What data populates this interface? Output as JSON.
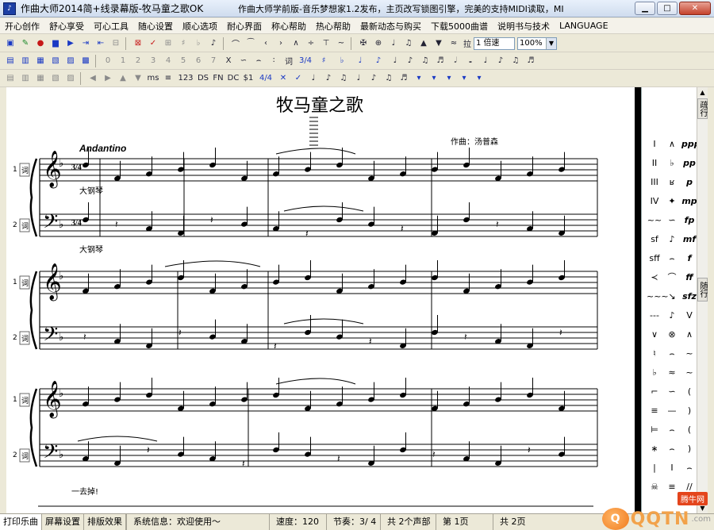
{
  "window": {
    "title": "作曲大师2014简+线录幕版-牧马童之歌OK",
    "title_right": "作曲大师学前版-音乐梦想家1.2发布，主页改写锁图引擎，完美的支持MIDI读取，MI",
    "controls": [
      "▁",
      "□",
      "✕"
    ]
  },
  "menu": [
    "开心创作",
    "舒心享受",
    "可心工具",
    "随心设置",
    "顺心选项",
    "耐心界面",
    "称心帮助",
    "热心帮助",
    "最新动态与购买",
    "下载5000曲谱",
    "说明书与技术",
    "LANGUAGE"
  ],
  "toolbar1": {
    "icons": [
      "▣",
      "✎",
      "●",
      "▆",
      "▶",
      "⇥",
      "⇤",
      "⊟",
      "⊠",
      "✓",
      "⊞",
      "♯",
      "♭",
      "♪",
      "⌒",
      "⁀",
      "‹",
      "›",
      "∧",
      "÷",
      "⊤",
      "~",
      "✠",
      "⊕",
      "♩",
      "♫",
      "▲",
      "▼",
      "≈"
    ],
    "zoom_label": "拉",
    "stretch_value": "1 倍速",
    "zoom_value": "100%"
  },
  "toolbar2": {
    "labels": [
      "0",
      "1",
      "2",
      "3",
      "4",
      "5",
      "6",
      "7",
      "X",
      "∽",
      "⌢",
      "∶",
      "词",
      "3/4",
      "♯",
      "♭",
      "♩",
      "♪"
    ]
  },
  "toolbar3": {
    "labels": [
      "ms",
      "≡",
      "123",
      "DS",
      "FN",
      "DC",
      "$1",
      "4/4",
      "✕",
      "✓",
      "♩",
      "♪",
      "♫"
    ]
  },
  "score": {
    "title": "牧马童之歌",
    "composer": "作曲：汤普森",
    "tempo": "Andantino",
    "instrument_1": "大钢琴",
    "instrument_2": "大钢琴",
    "staff_labels": [
      "1",
      "2",
      "1",
      "2",
      "1",
      "2"
    ],
    "lyric_marker": "词",
    "footnote": "一去掉!",
    "time_sig": "3/4"
  },
  "right_panel": {
    "top_tab": "疏行",
    "mid_tab": "随行",
    "symbols_left": [
      "I",
      "II",
      "III",
      "IV",
      "~~",
      "sf",
      "sff",
      "≺",
      "~~~",
      "---",
      "∨",
      "♮",
      "♭",
      "⌐",
      "≡",
      "⊨",
      "∗",
      "|",
      "☠"
    ],
    "symbols_mid": [
      "∧",
      "♭",
      "ʁ",
      "✦",
      "∽",
      "♪",
      "⌢",
      "⌒",
      "↘",
      "♪",
      "⊗",
      "⌢",
      "≈",
      "∽",
      "—",
      "⌢",
      "⌢",
      "I",
      "≡"
    ],
    "symbols_right": [
      "ppp",
      "pp",
      "p",
      "mp",
      "fp",
      "mf",
      "f",
      "ff",
      "sfz",
      "V",
      "∧",
      "~",
      "~",
      "(",
      ")",
      "(",
      ")",
      "⌢",
      "//"
    ]
  },
  "status": {
    "tabs": [
      "打印乐曲",
      "屏幕设置",
      "排版效果"
    ],
    "system_info": "系统信息：欢迎使用～",
    "speed": "速度：120",
    "meter": "节奏：3/ 4",
    "parts": "共 2个声部",
    "page": "第 1页",
    "total_pages": "共 2页"
  },
  "watermark": {
    "logo": "Q",
    "text": "QQTN",
    "domain": ".com",
    "badge": "腾牛网"
  },
  "colors": {
    "title_accent": "#1c3fa5",
    "watermark_orange": "#f07a1c",
    "tool_blue": "#1a39c4",
    "tool_red": "#c61818"
  }
}
